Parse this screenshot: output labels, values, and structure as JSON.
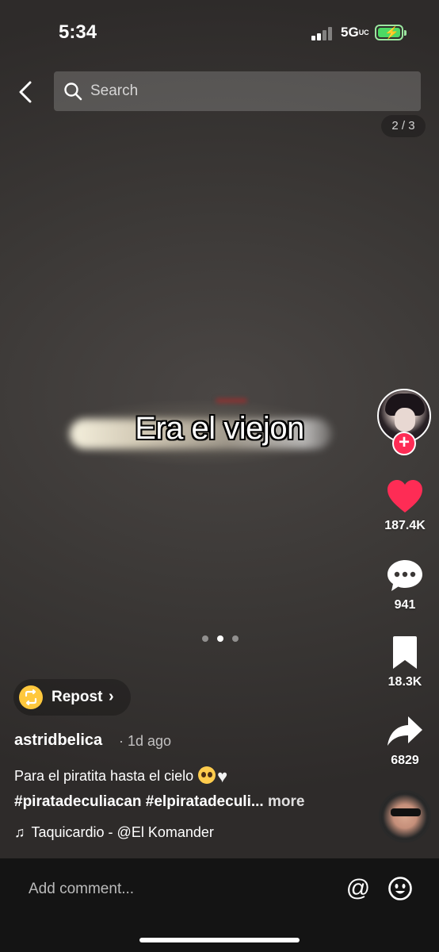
{
  "status_bar": {
    "time": "5:34",
    "network": "5G",
    "network_suffix": "UC"
  },
  "search": {
    "placeholder": "Search"
  },
  "page_indicator": "2 / 3",
  "video": {
    "overlay_text": "Era el viejon",
    "carousel_dots": 3,
    "active_dot": 2
  },
  "actions": {
    "likes": "187.4K",
    "comments": "941",
    "bookmarks": "18.3K",
    "shares": "6829"
  },
  "colors": {
    "like": "#fe2c55",
    "repost_icon": "#ffc83d"
  },
  "repost": {
    "label": "Repost"
  },
  "post": {
    "username": "astridbelica",
    "time_ago": "· 1d ago",
    "caption": "Para el piratita hasta el cielo",
    "hashtags": "#piratadeculiacan #elpiratadeculi...",
    "more_label": " more",
    "music": "Taquicardio - @El Komander"
  },
  "comment_bar": {
    "placeholder": "Add comment..."
  }
}
